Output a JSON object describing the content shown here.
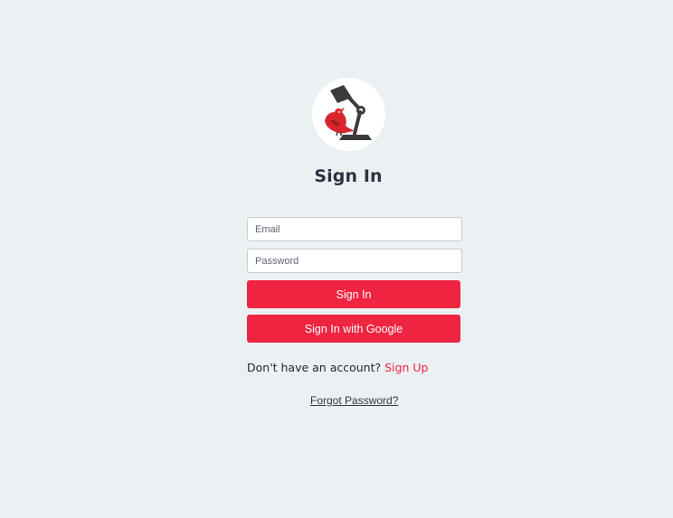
{
  "logo": {
    "icon": "lamp-bird-logo-icon"
  },
  "title": "Sign In",
  "form": {
    "email_placeholder": "Email",
    "password_placeholder": "Password",
    "signin_label": "Sign In",
    "google_label": "Sign In with Google"
  },
  "signup": {
    "prompt": "Don't have an account?",
    "link": "Sign Up"
  },
  "forgot": "Forgot Password?",
  "colors": {
    "background": "#ebf0f3",
    "accent": "#ee2440",
    "text": "#2b3140"
  }
}
